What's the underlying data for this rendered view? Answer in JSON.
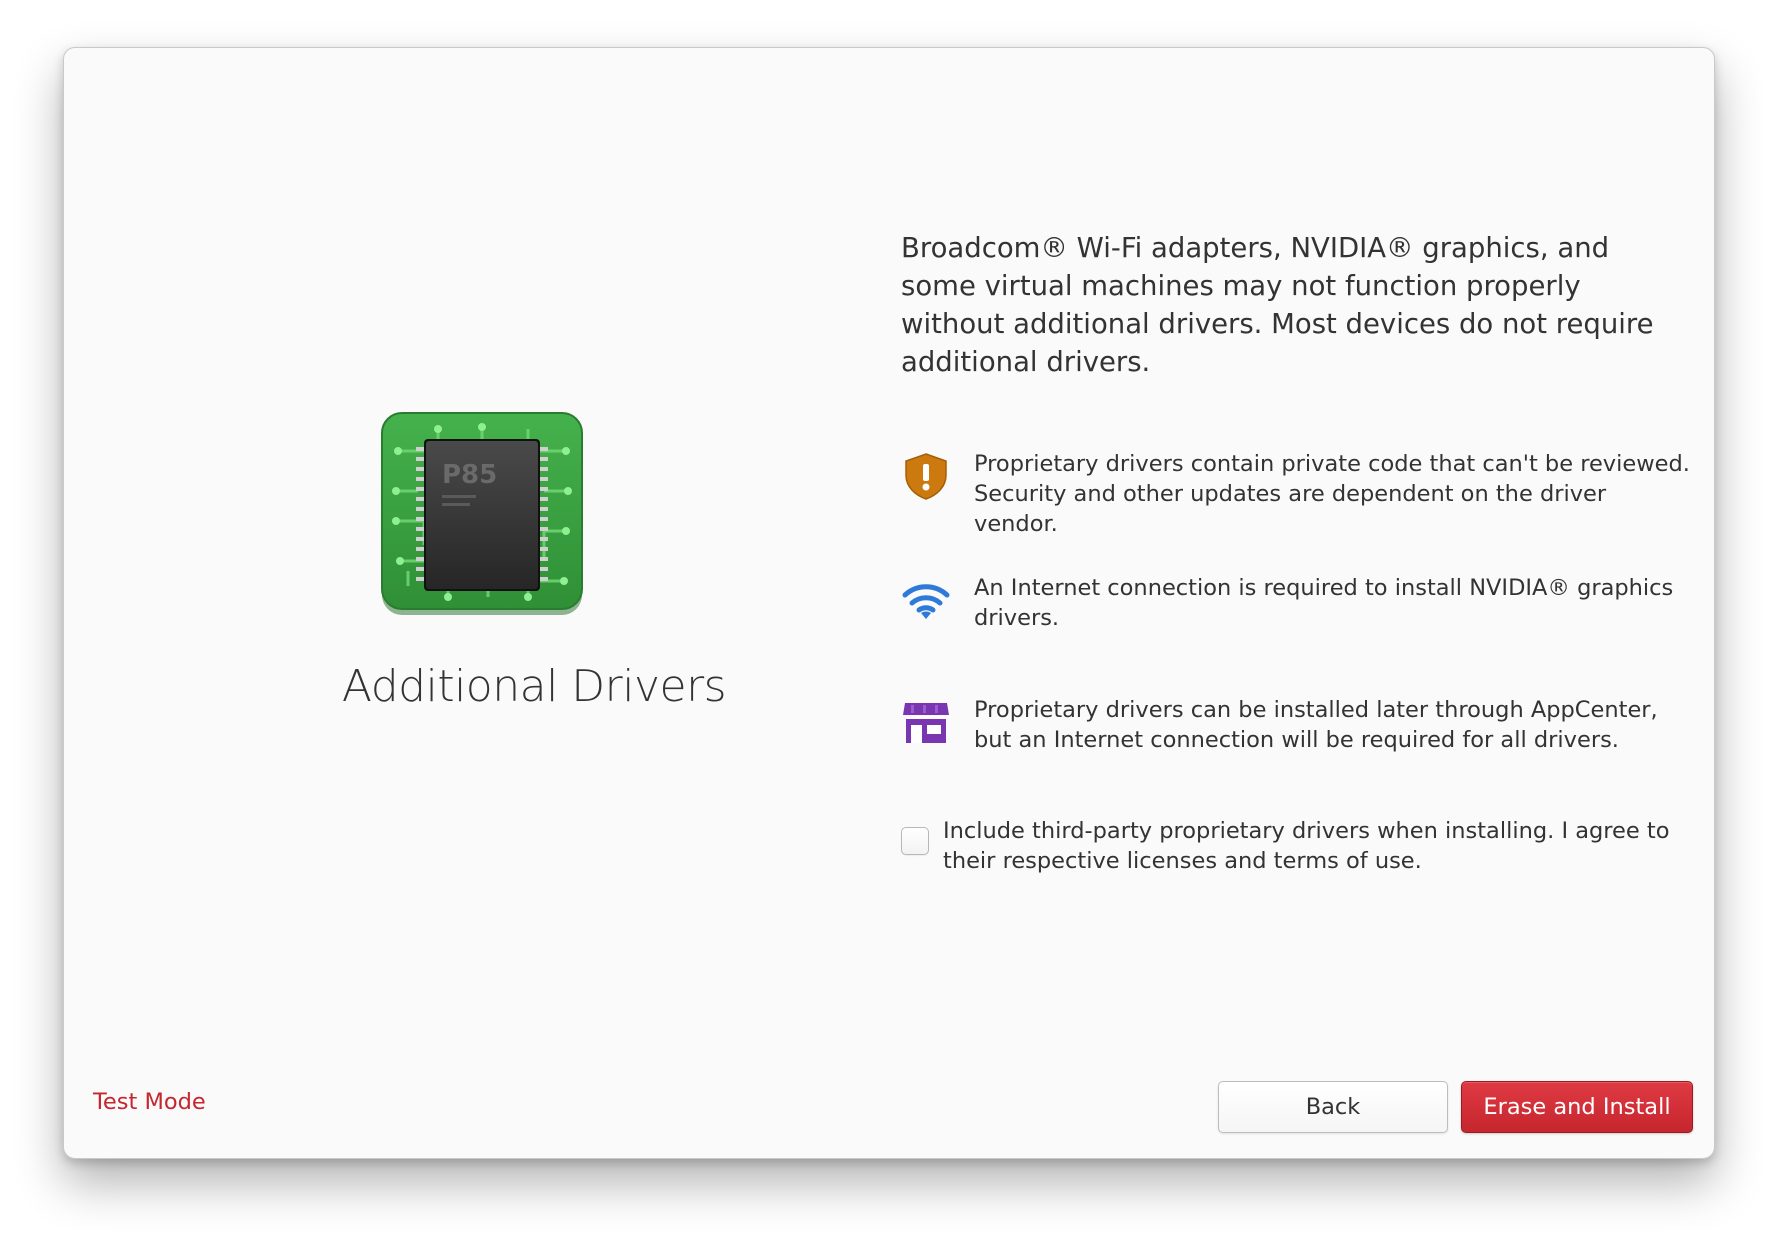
{
  "window": {
    "title": "Additional Drivers"
  },
  "left": {
    "icon": "chip-icon",
    "chip_label": "P85",
    "title": "Additional Drivers"
  },
  "description": "Broadcom® Wi-Fi adapters, NVIDIA® graphics, and some virtual machines may not function properly without additional drivers. Most devices do not require additional drivers.",
  "info": [
    {
      "icon": "shield-warning-icon",
      "text": "Proprietary drivers contain private code that can't be reviewed. Security and other updates are dependent on the driver vendor."
    },
    {
      "icon": "wifi-icon",
      "text": "An Internet connection is required to install NVIDIA® graphics drivers."
    },
    {
      "icon": "appcenter-store-icon",
      "text": "Proprietary drivers can be installed later through AppCenter, but an Internet connection will be required for all drivers."
    }
  ],
  "checkbox": {
    "label": "Include third-party proprietary drivers when installing. I agree to their respective licenses and terms of use.",
    "checked": false
  },
  "footer": {
    "test_mode": "Test Mode",
    "back_label": "Back",
    "install_label": "Erase and Install"
  },
  "colors": {
    "accent_red": "#c6262e",
    "shield_orange": "#cc7a0f",
    "wifi_blue": "#2e7ad8",
    "store_purple": "#7a36b1",
    "chip_green": "#3aa142"
  }
}
